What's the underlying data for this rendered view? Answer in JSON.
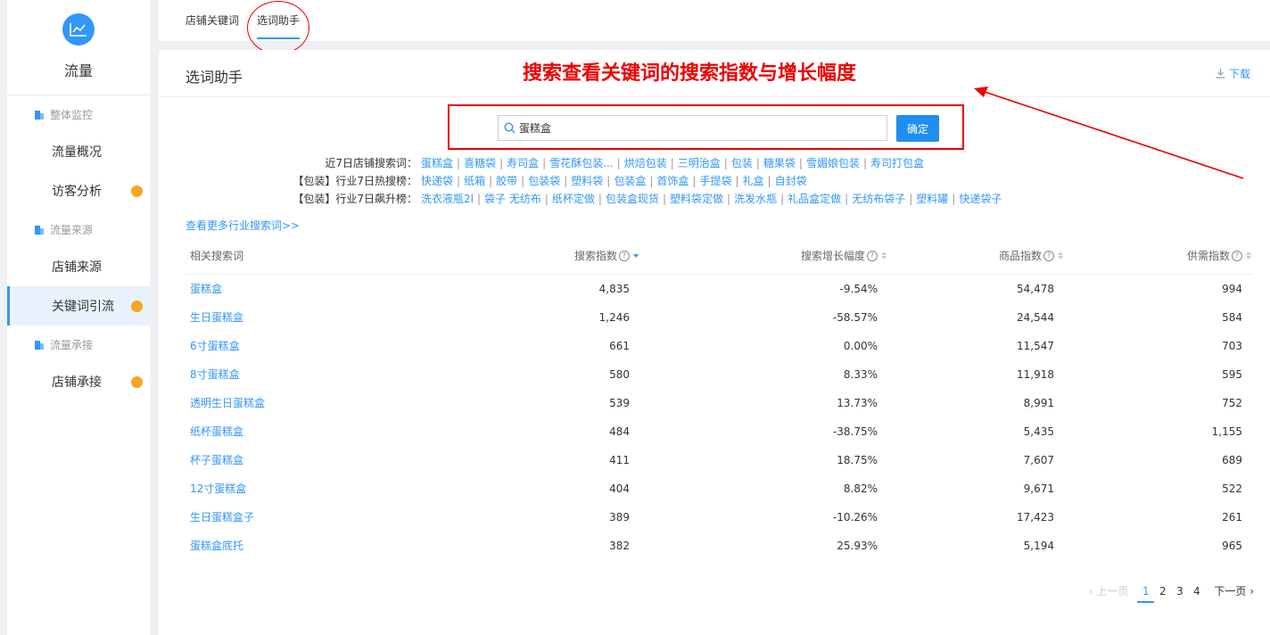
{
  "sidebar": {
    "title": "流量",
    "groups": [
      {
        "label": "整体监控"
      },
      {
        "label": "流量来源"
      },
      {
        "label": "流量承接"
      }
    ],
    "items": [
      {
        "label": "流量概况"
      },
      {
        "label": "访客分析"
      },
      {
        "label": "店铺来源"
      },
      {
        "label": "关键词引流"
      },
      {
        "label": "店铺承接"
      }
    ]
  },
  "tabs": [
    {
      "label": "店铺关键词"
    },
    {
      "label": "选词助手"
    }
  ],
  "main": {
    "title": "选词助手",
    "download": "下载",
    "annotation": "搜索查看关键词的搜索指数与增长幅度",
    "search": {
      "value": "蛋糕盒",
      "button": "确定"
    },
    "keyword_rows": [
      {
        "label": "近7日店铺搜索词：",
        "items": [
          "蛋糕盒",
          "喜糖袋",
          "寿司盒",
          "雪花酥包装...",
          "烘焙包装",
          "三明治盒",
          "包装",
          "糖果袋",
          "雪媚娘包装",
          "寿司打包盒"
        ]
      },
      {
        "label": "【包装】行业7日热搜榜：",
        "items": [
          "快递袋",
          "纸箱",
          "胶带",
          "包装袋",
          "塑料袋",
          "包装盒",
          "首饰盒",
          "手提袋",
          "礼盒",
          "自封袋"
        ]
      },
      {
        "label": "【包装】行业7日飙升榜：",
        "items": [
          "洗衣液瓶2l",
          "袋子 无纺布",
          "纸杯定做",
          "包装盒现货",
          "塑料袋定做",
          "洗发水瓶",
          "礼品盒定做",
          "无纺布袋子",
          "塑料罐",
          "快递袋子"
        ]
      }
    ],
    "more_link": "查看更多行业搜索词>>",
    "table": {
      "headers": [
        "相关搜索词",
        "搜索指数",
        "搜索增长幅度",
        "商品指数",
        "供需指数"
      ],
      "rows": [
        [
          "蛋糕盒",
          "4,835",
          "-9.54%",
          "54,478",
          "994"
        ],
        [
          "生日蛋糕盒",
          "1,246",
          "-58.57%",
          "24,544",
          "584"
        ],
        [
          "6寸蛋糕盒",
          "661",
          "0.00%",
          "11,547",
          "703"
        ],
        [
          "8寸蛋糕盒",
          "580",
          "8.33%",
          "11,918",
          "595"
        ],
        [
          "透明生日蛋糕盒",
          "539",
          "13.73%",
          "8,991",
          "752"
        ],
        [
          "纸杯蛋糕盒",
          "484",
          "-38.75%",
          "5,435",
          "1,155"
        ],
        [
          "杯子蛋糕盒",
          "411",
          "18.75%",
          "7,607",
          "689"
        ],
        [
          "12寸蛋糕盒",
          "404",
          "8.82%",
          "9,671",
          "522"
        ],
        [
          "生日蛋糕盒子",
          "389",
          "-10.26%",
          "17,423",
          "261"
        ],
        [
          "蛋糕盒底托",
          "382",
          "25.93%",
          "5,194",
          "965"
        ]
      ]
    },
    "pagination": {
      "prev": "上一页",
      "pages": [
        "1",
        "2",
        "3",
        "4"
      ],
      "next": "下一页",
      "current": "1"
    }
  },
  "colors": {
    "accent": "#3296fa",
    "annotation": "#e00000",
    "badge": "#f5a623"
  }
}
